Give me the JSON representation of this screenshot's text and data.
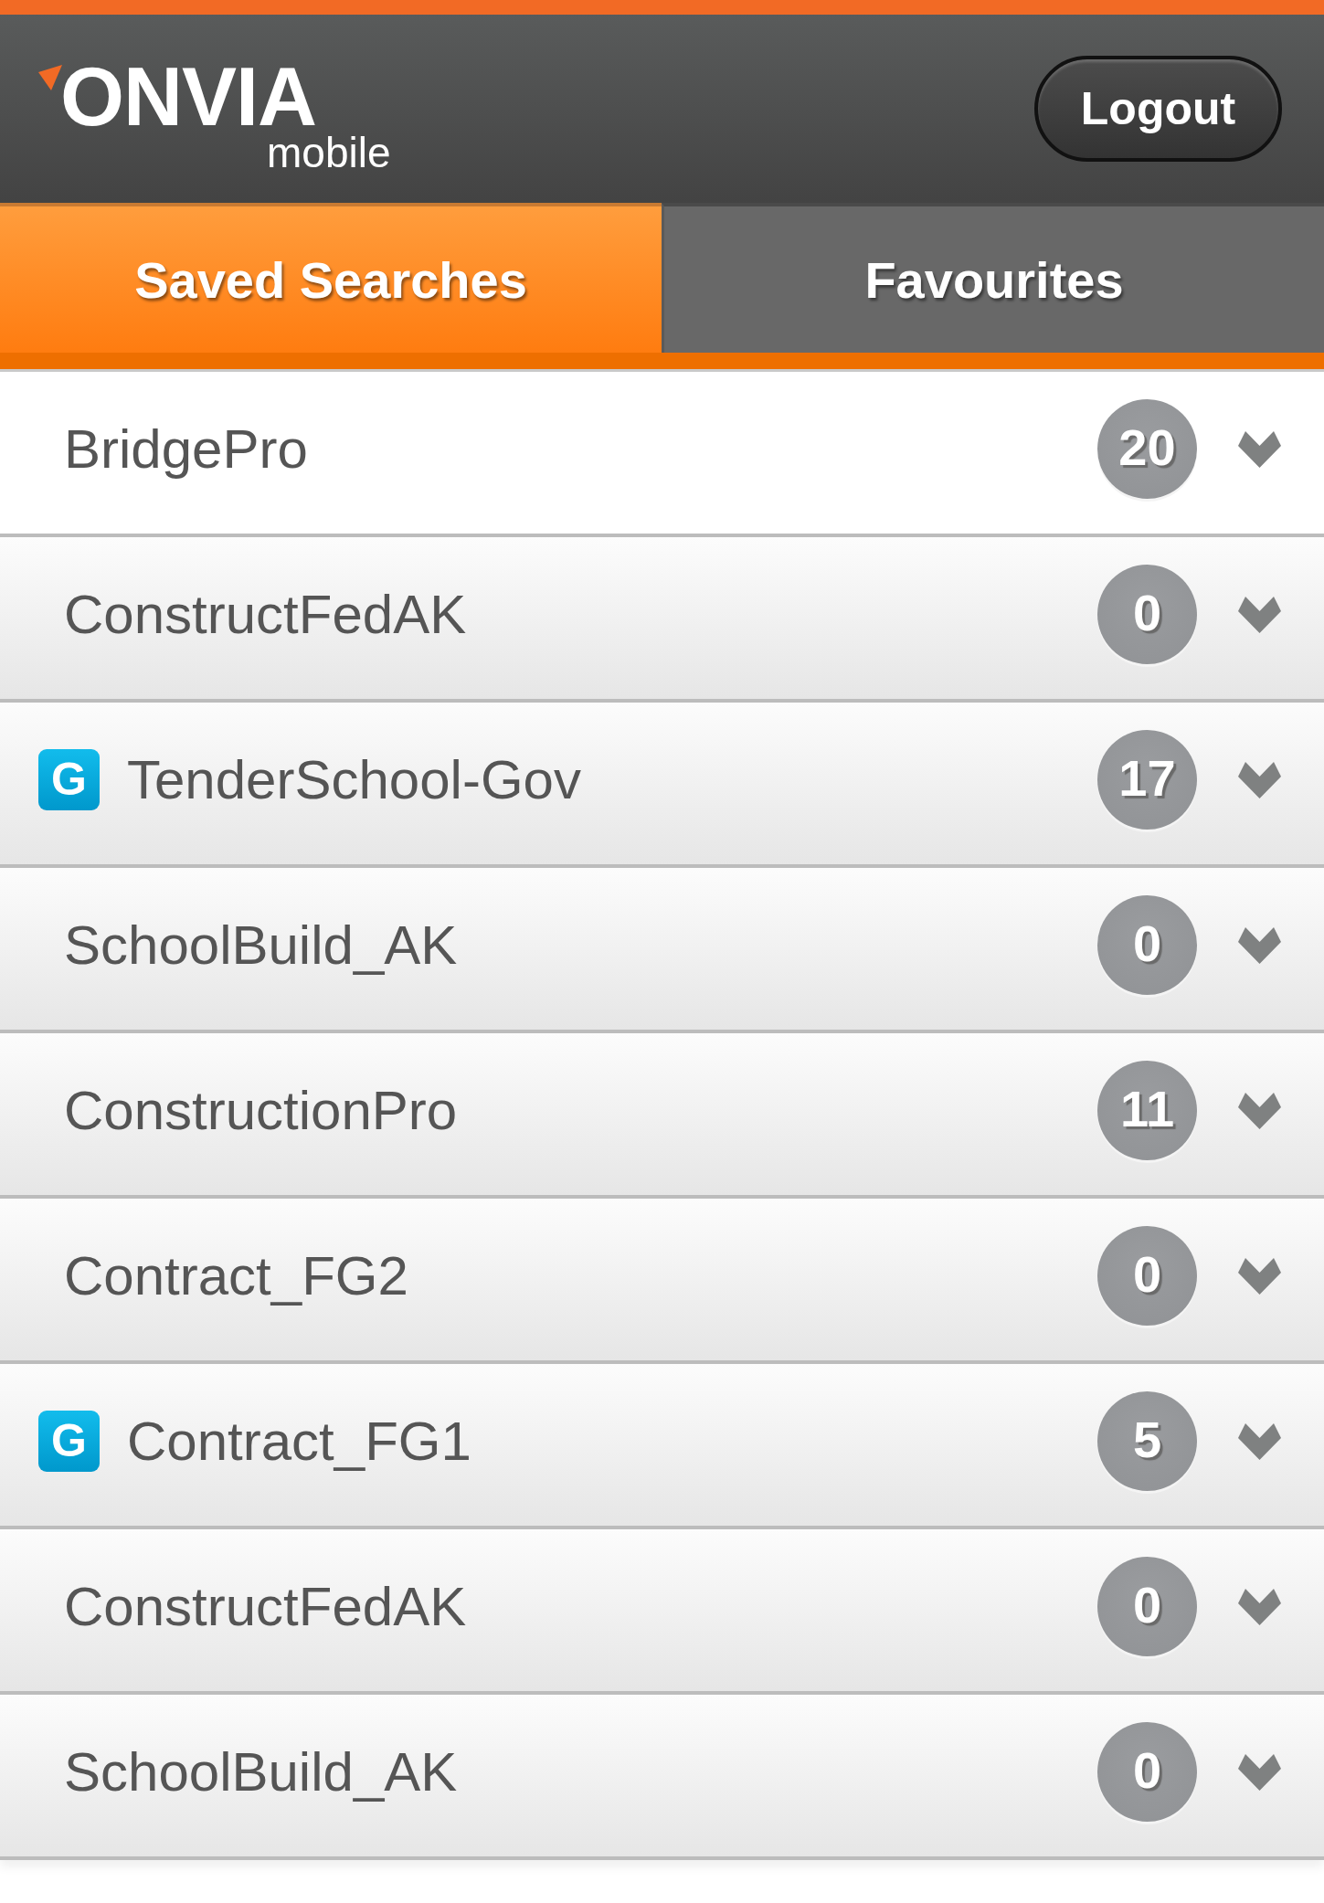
{
  "header": {
    "logo": {
      "wordmark": "ONVIA",
      "tagline": "mobile"
    },
    "logout_button": "Logout"
  },
  "tabs": [
    {
      "label": "Saved Searches",
      "selected": true
    },
    {
      "label": "Favourites",
      "selected": false
    }
  ],
  "saved_searches": [
    {
      "name": "BridgePro",
      "count": "20"
    },
    {
      "name": "ConstructFedAK",
      "count": "0"
    },
    {
      "tag": "G",
      "name": "TenderSchool-Gov",
      "count": "17"
    },
    {
      "name": "SchoolBuild_AK",
      "count": "0"
    },
    {
      "name": "ConstructionPro",
      "count": "11"
    },
    {
      "name": "Contract_FG2",
      "count": "0"
    },
    {
      "tag": "G",
      "name": "Contract_FG1",
      "count": "5"
    },
    {
      "name": "ConstructFedAK",
      "count": "0"
    },
    {
      "name": "SchoolBuild_AK",
      "count": "0"
    }
  ]
}
